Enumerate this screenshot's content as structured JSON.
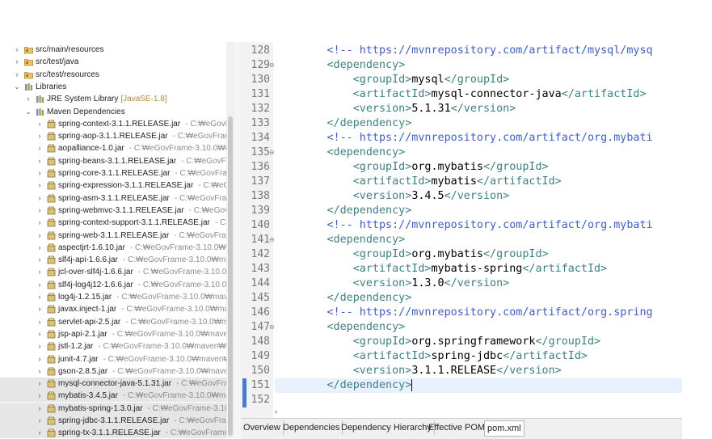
{
  "tree": [
    {
      "label": "src/main/resources",
      "path": "",
      "icon": "source-folder-icon",
      "twisty": "›",
      "indent": 0
    },
    {
      "label": "src/test/java",
      "path": "",
      "icon": "source-folder-icon",
      "twisty": "›",
      "indent": 0
    },
    {
      "label": "src/test/resources",
      "path": "",
      "icon": "source-folder-icon",
      "twisty": "›",
      "indent": 0
    },
    {
      "label": "Libraries",
      "path": "",
      "icon": "library-icon",
      "twisty": "⌄",
      "indent": 0
    },
    {
      "label": "JRE System Library",
      "path": "",
      "jre": "[JavaSE-1.8]",
      "icon": "library-icon",
      "twisty": "›",
      "indent": 1
    },
    {
      "label": "Maven Dependencies",
      "path": "",
      "icon": "library-icon",
      "twisty": "⌄",
      "indent": 1
    },
    {
      "label": "spring-context-3.1.1.RELEASE.jar",
      "path": "- C:₩eGovFram",
      "icon": "jar-icon",
      "twisty": "›",
      "indent": 2
    },
    {
      "label": "spring-aop-3.1.1.RELEASE.jar",
      "path": "- C:₩eGovFram",
      "icon": "jar-icon",
      "twisty": "›",
      "indent": 2
    },
    {
      "label": "aopalliance-1.0.jar",
      "path": "- C:₩eGovFrame-3.10.0₩m",
      "icon": "jar-icon",
      "twisty": "›",
      "indent": 2
    },
    {
      "label": "spring-beans-3.1.1.RELEASE.jar",
      "path": "- C:₩eGovFran",
      "icon": "jar-icon",
      "twisty": "›",
      "indent": 2
    },
    {
      "label": "spring-core-3.1.1.RELEASE.jar",
      "path": "- C:₩eGovFrame",
      "icon": "jar-icon",
      "twisty": "›",
      "indent": 2
    },
    {
      "label": "spring-expression-3.1.1.RELEASE.jar",
      "path": "- C:₩eGo",
      "icon": "jar-icon",
      "twisty": "›",
      "indent": 2
    },
    {
      "label": "spring-asm-3.1.1.RELEASE.jar",
      "path": "- C:₩eGovFrame",
      "icon": "jar-icon",
      "twisty": "›",
      "indent": 2
    },
    {
      "label": "spring-webmvc-3.1.1.RELEASE.jar",
      "path": "- C:₩eGovFr",
      "icon": "jar-icon",
      "twisty": "›",
      "indent": 2
    },
    {
      "label": "spring-context-support-3.1.1.RELEASE.jar",
      "path": "- C:₩",
      "icon": "jar-icon",
      "twisty": "›",
      "indent": 2
    },
    {
      "label": "spring-web-3.1.1.RELEASE.jar",
      "path": "- C:₩eGovFrame",
      "icon": "jar-icon",
      "twisty": "›",
      "indent": 2
    },
    {
      "label": "aspectjrt-1.6.10.jar",
      "path": "- C:₩eGovFrame-3.10.0₩m",
      "icon": "jar-icon",
      "twisty": "›",
      "indent": 2
    },
    {
      "label": "slf4j-api-1.6.6.jar",
      "path": "- C:₩eGovFrame-3.10.0₩mav",
      "icon": "jar-icon",
      "twisty": "›",
      "indent": 2
    },
    {
      "label": "jcl-over-slf4j-1.6.6.jar",
      "path": "- C:₩eGovFrame-3.10.0₩",
      "icon": "jar-icon",
      "twisty": "›",
      "indent": 2
    },
    {
      "label": "slf4j-log4j12-1.6.6.jar",
      "path": "- C:₩eGovFrame-3.10.0₩",
      "icon": "jar-icon",
      "twisty": "›",
      "indent": 2
    },
    {
      "label": "log4j-1.2.15.jar",
      "path": "- C:₩eGovFrame-3.10.0₩maven",
      "icon": "jar-icon",
      "twisty": "›",
      "indent": 2
    },
    {
      "label": "javax.inject-1.jar",
      "path": "- C:₩eGovFrame-3.10.0₩mav",
      "icon": "jar-icon",
      "twisty": "›",
      "indent": 2
    },
    {
      "label": "servlet-api-2.5.jar",
      "path": "- C:₩eGovFrame-3.10.0₩ma",
      "icon": "jar-icon",
      "twisty": "›",
      "indent": 2
    },
    {
      "label": "jsp-api-2.1.jar",
      "path": "- C:₩eGovFrame-3.10.0₩maven",
      "icon": "jar-icon",
      "twisty": "›",
      "indent": 2
    },
    {
      "label": "jstl-1.2.jar",
      "path": "- C:₩eGovFrame-3.10.0₩maven₩rep",
      "icon": "jar-icon",
      "twisty": "›",
      "indent": 2
    },
    {
      "label": "junit-4.7.jar",
      "path": "- C:₩eGovFrame-3.10.0₩maven₩r",
      "icon": "jar-icon",
      "twisty": "›",
      "indent": 2
    },
    {
      "label": "gson-2.8.5.jar",
      "path": "- C:₩eGovFrame-3.10.0₩maven₩",
      "icon": "jar-icon",
      "twisty": "›",
      "indent": 2
    },
    {
      "label": "mysql-connector-java-5.1.31.jar",
      "path": "- C:₩eGovFra",
      "icon": "jar-icon",
      "twisty": "›",
      "indent": 2,
      "selected": true
    },
    {
      "label": "mybatis-3.4.5.jar",
      "path": "- C:₩eGovFrame-3.10.0₩mav",
      "icon": "jar-icon",
      "twisty": "›",
      "indent": 2,
      "selected": true
    },
    {
      "label": "mybatis-spring-1.3.0.jar",
      "path": "- C:₩eGovFrame-3.10.",
      "icon": "jar-icon",
      "twisty": "›",
      "indent": 2,
      "selected": true
    },
    {
      "label": "spring-jdbc-3.1.1.RELEASE.jar",
      "path": "- C:₩eGovFrame",
      "icon": "jar-icon",
      "twisty": "›",
      "indent": 2,
      "selected": true
    },
    {
      "label": "spring-tx-3.1.1.RELEASE.jar",
      "path": "- C:₩eGovFrame-3",
      "icon": "jar-icon",
      "twisty": "›",
      "indent": 2,
      "selected": true
    }
  ],
  "editor": {
    "lines": [
      {
        "n": "128",
        "fold": "",
        "parts": [
          {
            "t": "        ",
            "c": "text"
          },
          {
            "t": "<!-- https://mvnrepository.com/artifact/mysql/mysq",
            "c": "comment"
          }
        ]
      },
      {
        "n": "129",
        "fold": "⊖",
        "parts": [
          {
            "t": "        ",
            "c": "text"
          },
          {
            "t": "<dependency>",
            "c": "tag"
          }
        ]
      },
      {
        "n": "130",
        "fold": "",
        "parts": [
          {
            "t": "            ",
            "c": "text"
          },
          {
            "t": "<groupId>",
            "c": "tag"
          },
          {
            "t": "mysql",
            "c": "text"
          },
          {
            "t": "</groupId>",
            "c": "tag"
          }
        ]
      },
      {
        "n": "131",
        "fold": "",
        "parts": [
          {
            "t": "            ",
            "c": "text"
          },
          {
            "t": "<artifactId>",
            "c": "tag"
          },
          {
            "t": "mysql-connector-java",
            "c": "text"
          },
          {
            "t": "</artifactId>",
            "c": "tag"
          }
        ]
      },
      {
        "n": "132",
        "fold": "",
        "parts": [
          {
            "t": "            ",
            "c": "text"
          },
          {
            "t": "<version>",
            "c": "tag"
          },
          {
            "t": "5.1.31",
            "c": "text"
          },
          {
            "t": "</version>",
            "c": "tag"
          }
        ]
      },
      {
        "n": "133",
        "fold": "",
        "parts": [
          {
            "t": "        ",
            "c": "text"
          },
          {
            "t": "</dependency>",
            "c": "tag"
          }
        ]
      },
      {
        "n": "134",
        "fold": "",
        "parts": [
          {
            "t": "        ",
            "c": "text"
          },
          {
            "t": "<!-- https://mvnrepository.com/artifact/org.mybati",
            "c": "comment"
          }
        ]
      },
      {
        "n": "135",
        "fold": "⊖",
        "parts": [
          {
            "t": "        ",
            "c": "text"
          },
          {
            "t": "<dependency>",
            "c": "tag"
          }
        ]
      },
      {
        "n": "136",
        "fold": "",
        "parts": [
          {
            "t": "            ",
            "c": "text"
          },
          {
            "t": "<groupId>",
            "c": "tag"
          },
          {
            "t": "org.mybatis",
            "c": "text"
          },
          {
            "t": "</groupId>",
            "c": "tag"
          }
        ]
      },
      {
        "n": "137",
        "fold": "",
        "parts": [
          {
            "t": "            ",
            "c": "text"
          },
          {
            "t": "<artifactId>",
            "c": "tag"
          },
          {
            "t": "mybatis",
            "c": "text"
          },
          {
            "t": "</artifactId>",
            "c": "tag"
          }
        ]
      },
      {
        "n": "138",
        "fold": "",
        "parts": [
          {
            "t": "            ",
            "c": "text"
          },
          {
            "t": "<version>",
            "c": "tag"
          },
          {
            "t": "3.4.5",
            "c": "text"
          },
          {
            "t": "</version>",
            "c": "tag"
          }
        ]
      },
      {
        "n": "139",
        "fold": "",
        "parts": [
          {
            "t": "        ",
            "c": "text"
          },
          {
            "t": "</dependency>",
            "c": "tag"
          }
        ]
      },
      {
        "n": "140",
        "fold": "",
        "parts": [
          {
            "t": "        ",
            "c": "text"
          },
          {
            "t": "<!-- https://mvnrepository.com/artifact/org.mybati",
            "c": "comment"
          }
        ]
      },
      {
        "n": "141",
        "fold": "⊖",
        "parts": [
          {
            "t": "        ",
            "c": "text"
          },
          {
            "t": "<dependency>",
            "c": "tag"
          }
        ]
      },
      {
        "n": "142",
        "fold": "",
        "parts": [
          {
            "t": "            ",
            "c": "text"
          },
          {
            "t": "<groupId>",
            "c": "tag"
          },
          {
            "t": "org.mybatis",
            "c": "text"
          },
          {
            "t": "</groupId>",
            "c": "tag"
          }
        ]
      },
      {
        "n": "143",
        "fold": "",
        "parts": [
          {
            "t": "            ",
            "c": "text"
          },
          {
            "t": "<artifactId>",
            "c": "tag"
          },
          {
            "t": "mybatis-spring",
            "c": "text"
          },
          {
            "t": "</artifactId>",
            "c": "tag"
          }
        ]
      },
      {
        "n": "144",
        "fold": "",
        "parts": [
          {
            "t": "            ",
            "c": "text"
          },
          {
            "t": "<version>",
            "c": "tag"
          },
          {
            "t": "1.3.0",
            "c": "text"
          },
          {
            "t": "</version>",
            "c": "tag"
          }
        ]
      },
      {
        "n": "145",
        "fold": "",
        "parts": [
          {
            "t": "        ",
            "c": "text"
          },
          {
            "t": "</dependency>",
            "c": "tag"
          }
        ]
      },
      {
        "n": "146",
        "fold": "",
        "parts": [
          {
            "t": "        ",
            "c": "text"
          },
          {
            "t": "<!-- https://mvnrepository.com/artifact/org.spring",
            "c": "comment"
          }
        ]
      },
      {
        "n": "147",
        "fold": "⊖",
        "parts": [
          {
            "t": "        ",
            "c": "text"
          },
          {
            "t": "<dependency>",
            "c": "tag"
          }
        ]
      },
      {
        "n": "148",
        "fold": "",
        "parts": [
          {
            "t": "            ",
            "c": "text"
          },
          {
            "t": "<groupId>",
            "c": "tag"
          },
          {
            "t": "org.springframework",
            "c": "text"
          },
          {
            "t": "</groupId>",
            "c": "tag"
          }
        ]
      },
      {
        "n": "149",
        "fold": "",
        "parts": [
          {
            "t": "            ",
            "c": "text"
          },
          {
            "t": "<artifactId>",
            "c": "tag"
          },
          {
            "t": "spring-jdbc",
            "c": "text"
          },
          {
            "t": "</artifactId>",
            "c": "tag"
          }
        ]
      },
      {
        "n": "150",
        "fold": "",
        "parts": [
          {
            "t": "            ",
            "c": "text"
          },
          {
            "t": "<version>",
            "c": "tag"
          },
          {
            "t": "3.1.1.RELEASE",
            "c": "text"
          },
          {
            "t": "</version>",
            "c": "tag"
          }
        ]
      },
      {
        "n": "151",
        "fold": "",
        "current": true,
        "parts": [
          {
            "t": "        ",
            "c": "text"
          },
          {
            "t": "</dependency>",
            "c": "tag"
          }
        ]
      },
      {
        "n": "152",
        "fold": "",
        "parts": []
      }
    ]
  },
  "tabs": [
    {
      "label": "Overview"
    },
    {
      "label": "Dependencies"
    },
    {
      "label": "Dependency Hierarchy"
    },
    {
      "label": "Effective POM"
    },
    {
      "label": "pom.xml",
      "active": true
    }
  ],
  "colors": {
    "comment": "#3f5fbf",
    "tag": "#3f7f7f",
    "text": "#000000",
    "selection": "#e6e6e6"
  }
}
